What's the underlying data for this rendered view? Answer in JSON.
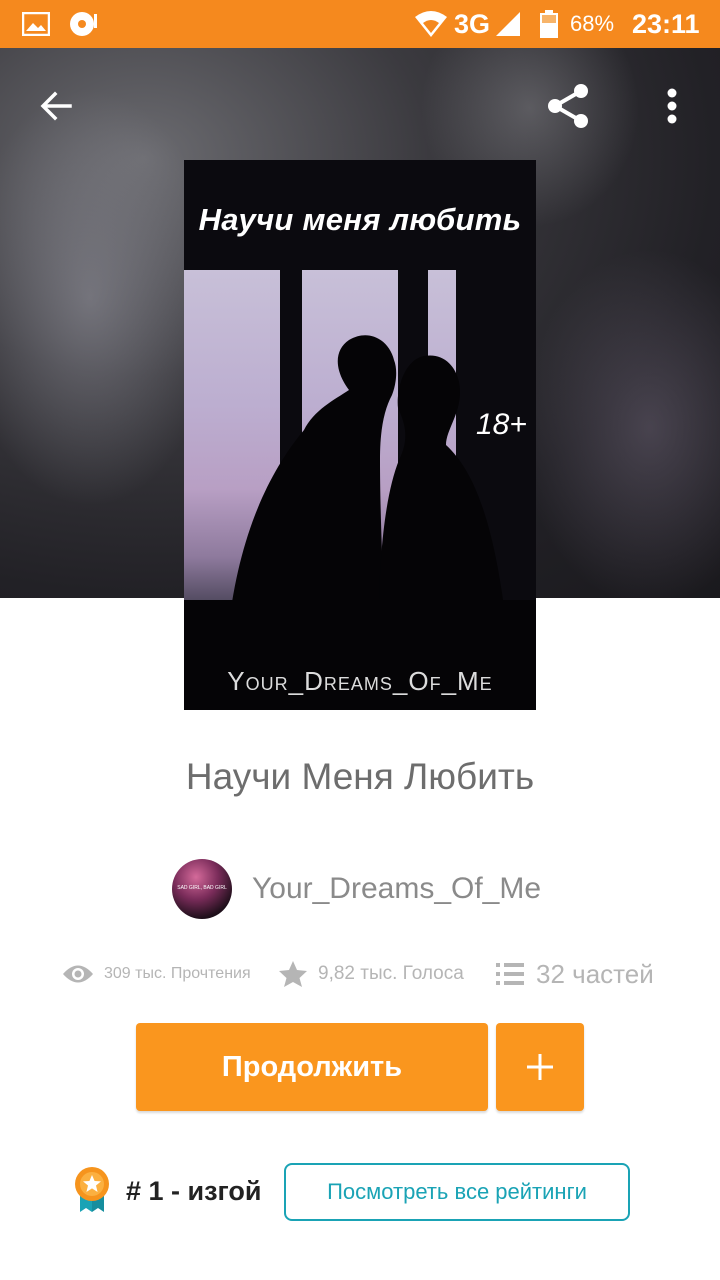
{
  "status_bar": {
    "network": "3G",
    "battery_percent": "68%",
    "time": "23:11",
    "bg_color": "#f5891e",
    "icons": [
      "gallery-icon",
      "media-icon",
      "wifi-icon",
      "signal-icon",
      "battery-icon"
    ]
  },
  "toolbar": {
    "back_icon": "arrow-left-icon",
    "share_icon": "share-icon",
    "more_icon": "more-vertical-icon"
  },
  "cover": {
    "title": "Научи меня любить",
    "age_label": "18+",
    "author": "Your_Dreams_Of_Me"
  },
  "book": {
    "title": "Научи Меня Любить",
    "author": "Your_Dreams_Of_Me",
    "avatar_text": "SAD GIRL, BAD GIRL"
  },
  "stats": {
    "reads": "309 тыс. Прочтения",
    "votes": "9,82 тыс. Голоса",
    "parts": "32 частей"
  },
  "actions": {
    "continue_label": "Продолжить",
    "add_icon": "plus-icon",
    "accent_color": "#fa961e"
  },
  "ranking": {
    "rank_text": "# 1 - изгой",
    "view_all_label": "Посмотреть все рейтинги",
    "badge_icon": "award-badge-icon"
  }
}
